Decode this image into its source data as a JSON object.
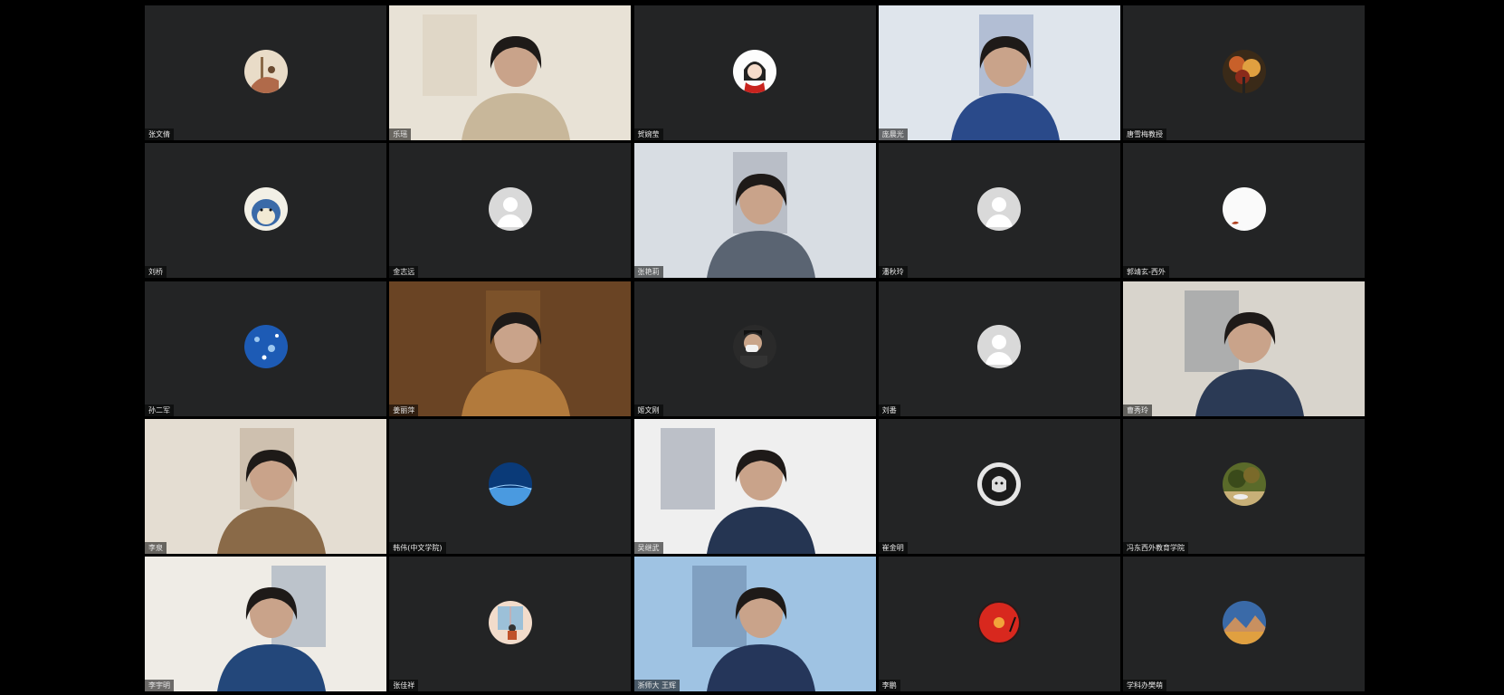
{
  "participants": [
    {
      "name": "张文倩",
      "kind": "avatar",
      "icon": "illustration-avatar-icon",
      "colors": [
        "#e9dcc8",
        "#b06a4a"
      ]
    },
    {
      "name": "乐瑶",
      "kind": "video",
      "icon": "video-feed",
      "colors": [
        "#e8e2d6",
        "#c8b79a"
      ]
    },
    {
      "name": "贺婉莹",
      "kind": "avatar",
      "icon": "cartoon-girl-avatar-icon",
      "colors": [
        "#fdfdfd",
        "#c8231e"
      ]
    },
    {
      "name": "庞晨光",
      "kind": "video",
      "icon": "video-feed",
      "colors": [
        "#dfe5ec",
        "#2a4a8a"
      ],
      "active": true
    },
    {
      "name": "唐雪梅教授",
      "kind": "avatar",
      "icon": "autumn-tree-avatar-icon",
      "colors": [
        "#3a2a18",
        "#c8602a"
      ]
    },
    {
      "name": "刘桥",
      "kind": "avatar",
      "icon": "cartoon-cat-avatar-icon",
      "colors": [
        "#f2f0e6",
        "#3a6aa8"
      ]
    },
    {
      "name": "金志远",
      "kind": "avatar",
      "icon": "default-person-avatar-icon",
      "colors": [
        "#d9d9d9",
        "#ffffff"
      ]
    },
    {
      "name": "张艳莉",
      "kind": "video",
      "icon": "video-feed",
      "colors": [
        "#d8dde3",
        "#5a6472"
      ]
    },
    {
      "name": "潘秋玲",
      "kind": "avatar",
      "icon": "default-person-avatar-icon",
      "colors": [
        "#d9d9d9",
        "#ffffff"
      ]
    },
    {
      "name": "郭靖玄-西外",
      "kind": "avatar",
      "icon": "white-circle-avatar-icon",
      "colors": [
        "#fafafa",
        "#b04020"
      ]
    },
    {
      "name": "孙二军",
      "kind": "avatar",
      "icon": "blue-sky-avatar-icon",
      "colors": [
        "#1d5bb5",
        "#9cc7f0"
      ]
    },
    {
      "name": "姜丽萍",
      "kind": "video",
      "icon": "video-feed",
      "colors": [
        "#6a4424",
        "#b27a3c"
      ]
    },
    {
      "name": "姬文刚",
      "kind": "avatar",
      "icon": "masked-person-avatar-icon",
      "colors": [
        "#2a2a2a",
        "#f2f2f2"
      ]
    },
    {
      "name": "刘番",
      "kind": "avatar",
      "icon": "default-person-avatar-icon",
      "colors": [
        "#d9d9d9",
        "#ffffff"
      ]
    },
    {
      "name": "曹秀玲",
      "kind": "video",
      "icon": "video-feed",
      "colors": [
        "#d8d4cc",
        "#2b3a55"
      ]
    },
    {
      "name": "李泉",
      "kind": "video",
      "icon": "video-feed",
      "colors": [
        "#e4ddd2",
        "#8a6a48"
      ]
    },
    {
      "name": "韩伟(中文学院)",
      "kind": "avatar",
      "icon": "blue-night-avatar-icon",
      "colors": [
        "#0a3a78",
        "#4a9ae0"
      ]
    },
    {
      "name": "吴继武",
      "kind": "video",
      "icon": "video-feed",
      "colors": [
        "#efefef",
        "#253552"
      ]
    },
    {
      "name": "崔金明",
      "kind": "avatar",
      "icon": "dark-portrait-avatar-icon",
      "colors": [
        "#1b1b1b",
        "#e6e6e6"
      ]
    },
    {
      "name": "冯东西外教育学院",
      "kind": "avatar",
      "icon": "forest-avatar-icon",
      "colors": [
        "#5a6a2a",
        "#c8b078"
      ]
    },
    {
      "name": "李宇明",
      "kind": "video",
      "icon": "video-feed",
      "colors": [
        "#efece6",
        "#23477a"
      ]
    },
    {
      "name": "张佳祥",
      "kind": "avatar",
      "icon": "girl-window-avatar-icon",
      "colors": [
        "#f2dccb",
        "#c0522a"
      ]
    },
    {
      "name": "浙师大 王辉",
      "kind": "video",
      "icon": "video-feed",
      "colors": [
        "#9fc3e3",
        "#25365a"
      ]
    },
    {
      "name": "李鹏",
      "kind": "avatar",
      "icon": "red-record-avatar-icon",
      "colors": [
        "#d8281e",
        "#f2a33a"
      ]
    },
    {
      "name": "学科办樊萌",
      "kind": "avatar",
      "icon": "mountain-sunset-avatar-icon",
      "colors": [
        "#3a6aa8",
        "#e0a040"
      ]
    }
  ]
}
